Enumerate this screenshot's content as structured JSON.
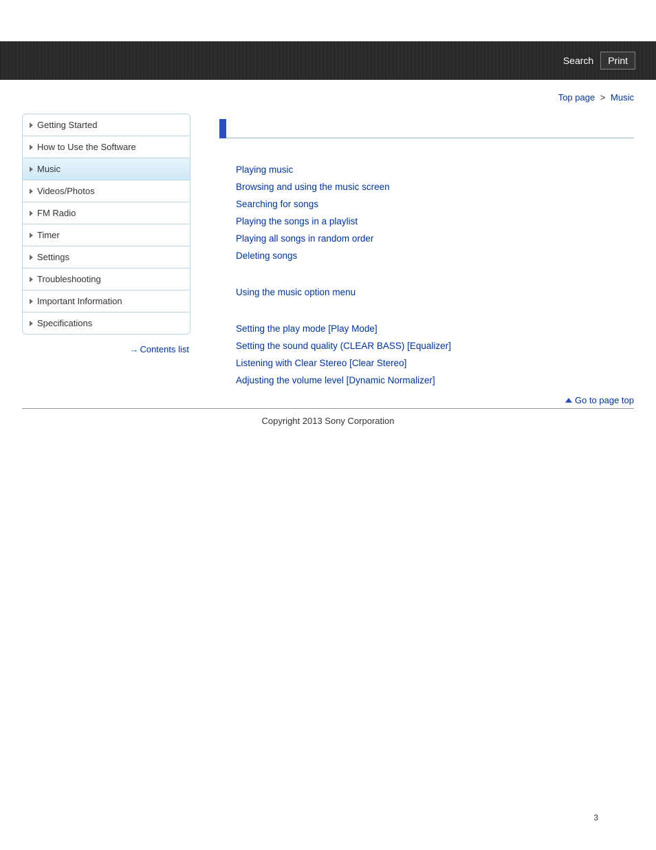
{
  "topbar": {
    "search_label": "Search",
    "print_label": "Print"
  },
  "breadcrumb": {
    "top_label": "Top page",
    "sep": ">",
    "current": "Music"
  },
  "sidebar": {
    "items": [
      {
        "label": "Getting Started"
      },
      {
        "label": "How to Use the Software"
      },
      {
        "label": "Music"
      },
      {
        "label": "Videos/Photos"
      },
      {
        "label": "FM Radio"
      },
      {
        "label": "Timer"
      },
      {
        "label": "Settings"
      },
      {
        "label": "Troubleshooting"
      },
      {
        "label": "Important Information"
      },
      {
        "label": "Specifications"
      }
    ],
    "contents_list_label": "Contents list"
  },
  "content": {
    "groups": [
      {
        "links": [
          "Playing music",
          "Browsing and using the music screen",
          "Searching for songs",
          "Playing the songs in a playlist",
          "Playing all songs in random order",
          "Deleting songs"
        ]
      },
      {
        "links": [
          "Using the music option menu"
        ]
      },
      {
        "links": [
          "Setting the play mode [Play Mode]",
          "Setting the sound quality (CLEAR BASS) [Equalizer]",
          "Listening with Clear Stereo [Clear Stereo]",
          "Adjusting the volume level [Dynamic Normalizer]"
        ]
      }
    ]
  },
  "footer": {
    "gotop_label": "Go to page top",
    "copyright": "Copyright 2013 Sony Corporation",
    "page_number": "3"
  }
}
